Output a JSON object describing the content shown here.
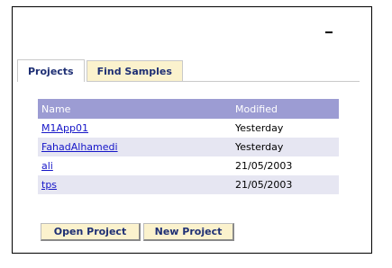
{
  "tabs": [
    {
      "label": "Projects",
      "active": true
    },
    {
      "label": "Find Samples",
      "active": false
    }
  ],
  "table": {
    "headers": [
      "Name",
      "Modified"
    ],
    "rows": [
      {
        "name": "M1App01",
        "modified": "Yesterday"
      },
      {
        "name": "FahadAlhamedi",
        "modified": "Yesterday"
      },
      {
        "name": "ali",
        "modified": "21/05/2003"
      },
      {
        "name": "tps",
        "modified": "21/05/2003"
      }
    ]
  },
  "buttons": {
    "open_label": "Open Project",
    "new_label": "New Project"
  },
  "colors": {
    "header_bg": "#9c9cd3",
    "alt_row_bg": "#e6e6f2",
    "button_bg": "#fbf2cd",
    "link": "#1616c8"
  }
}
